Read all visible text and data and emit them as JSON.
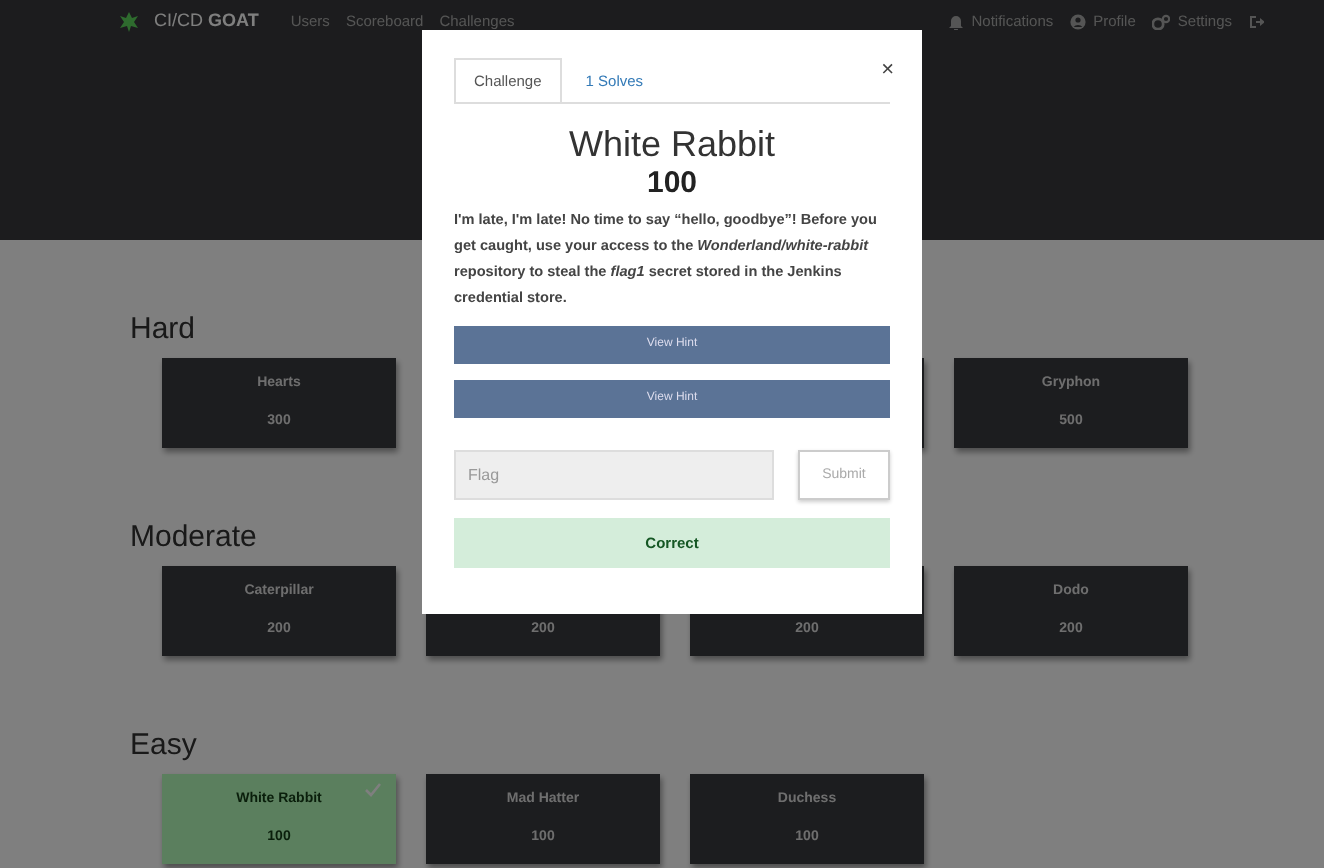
{
  "navbar": {
    "brand_light": "CI/CD",
    "brand_bold": "GOAT",
    "links": [
      "Users",
      "Scoreboard",
      "Challenges"
    ],
    "right_links": [
      {
        "kind": "bell",
        "label": "Notifications"
      },
      {
        "kind": "user",
        "label": "Profile"
      },
      {
        "kind": "gears",
        "label": "Settings"
      },
      {
        "kind": "logout"
      }
    ]
  },
  "categories": [
    {
      "name": "Hard",
      "cards": [
        {
          "kind": "card",
          "name": "Hearts",
          "value": "300",
          "solved": false
        },
        {
          "kind": "covered"
        },
        {
          "kind": "covered"
        },
        {
          "kind": "card",
          "name": "Gryphon",
          "value": "500",
          "solved": false
        }
      ]
    },
    {
      "name": "Moderate",
      "cards": [
        {
          "kind": "card",
          "name": "Caterpillar",
          "value": "200",
          "solved": false
        },
        {
          "kind": "partial",
          "value": "200"
        },
        {
          "kind": "partial",
          "value": "200"
        },
        {
          "kind": "card",
          "name": "Dodo",
          "value": "200",
          "solved": false
        }
      ]
    },
    {
      "name": "Easy",
      "cards": [
        {
          "kind": "card",
          "name": "White Rabbit",
          "value": "100",
          "solved": true
        },
        {
          "kind": "card",
          "name": "Mad Hatter",
          "value": "100",
          "solved": false
        },
        {
          "kind": "card",
          "name": "Duchess",
          "value": "100",
          "solved": false
        }
      ]
    }
  ],
  "modal": {
    "tabs": [
      {
        "label": "Challenge",
        "selected": true
      },
      {
        "label": "1 Solves",
        "selected": false
      }
    ],
    "close": "×",
    "title": "White Rabbit",
    "value": "100",
    "description": "I'm late, I'm late! No time to say “hello, goodbye”! Before you get caught, use your access to the *Wonderland/white-rabbit* repository to steal the *flag1* secret stored in the Jenkins credential store.",
    "hints": [
      "View Hint",
      "View Hint"
    ],
    "flag": {
      "placeholder": "Flag"
    },
    "submit": "Submit",
    "result": "Correct"
  }
}
